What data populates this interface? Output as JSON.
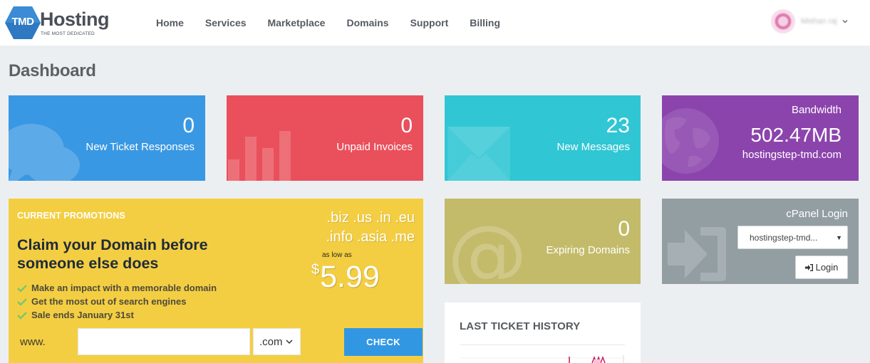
{
  "brand": {
    "mark": "TMD",
    "name": "Hosting",
    "tagline": "THE MOST DEDICATED"
  },
  "nav": [
    {
      "label": "Home"
    },
    {
      "label": "Services"
    },
    {
      "label": "Marketplace"
    },
    {
      "label": "Domains"
    },
    {
      "label": "Support"
    },
    {
      "label": "Billing"
    }
  ],
  "user": {
    "name": "Mishan raj"
  },
  "page": {
    "title": "Dashboard"
  },
  "stats": {
    "tickets": {
      "value": "0",
      "label": "New Ticket Responses",
      "color": "#3998e3"
    },
    "invoices": {
      "value": "0",
      "label": "Unpaid Invoices",
      "color": "#e9505c"
    },
    "messages": {
      "value": "23",
      "label": "New Messages",
      "color": "#30c6d4"
    },
    "bandwidth": {
      "title": "Bandwidth",
      "value": "502.47MB",
      "host": "hostingstep-tmd.com",
      "color": "#8c44ad"
    },
    "expiring": {
      "value": "0",
      "label": "Expiring Domains",
      "color": "#c3bb6a"
    }
  },
  "promo": {
    "tag": "CURRENT PROMOTIONS",
    "headline": "Claim your Domain before someone else does",
    "bullets": [
      "Make an impact with a memorable domain",
      "Get the most out of search engines",
      "Sale ends January 31st"
    ],
    "tld_line1": ".biz .us .in .eu",
    "tld_line2": ".info .asia .me",
    "as_low_as": "as low as",
    "currency": "$",
    "price": "5.99",
    "www": "www.",
    "input_value": "",
    "tld_selected": ".com",
    "check_label": "CHECK",
    "color": "#f4ce42"
  },
  "cpanel": {
    "title": "cPanel Login",
    "selected": "hostingstep-tmd...",
    "login_label": "Login",
    "color": "#939ea3"
  },
  "ticket_history": {
    "title": "LAST TICKET HISTORY"
  }
}
